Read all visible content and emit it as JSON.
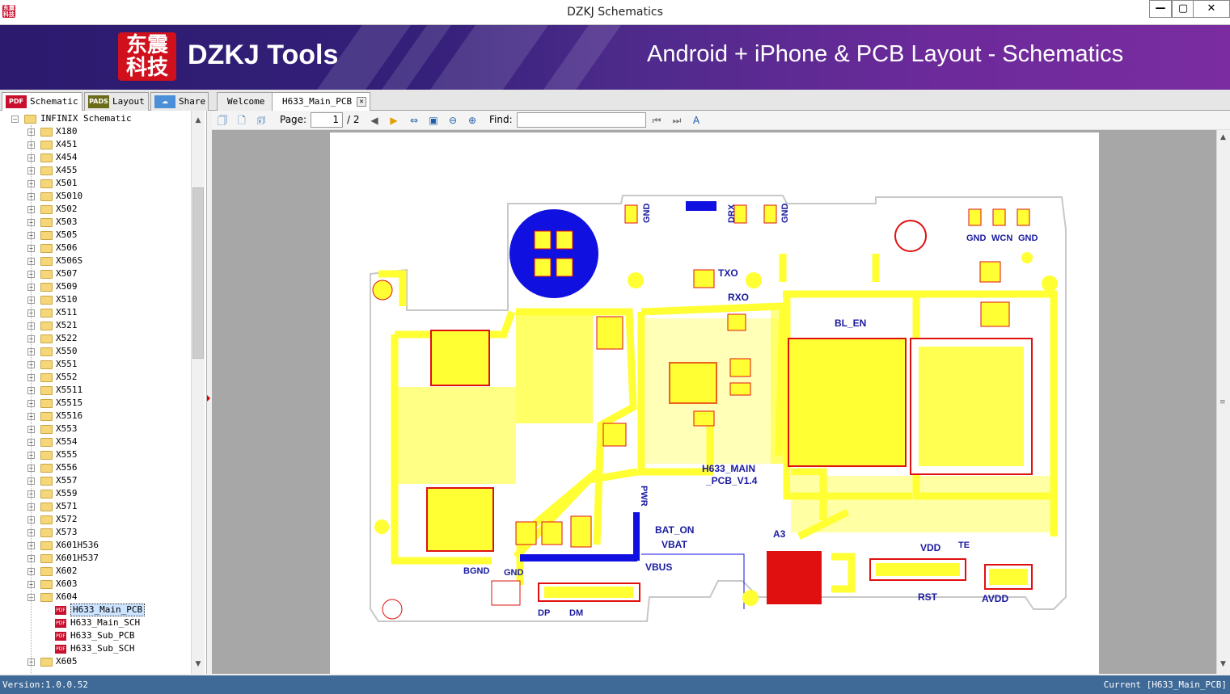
{
  "window": {
    "title": "DZKJ Schematics",
    "app_icon_text": "东震科技"
  },
  "banner": {
    "logo_text": "东震科技",
    "brand": "DZKJ Tools",
    "tagline": "Android + iPhone & PCB Layout - Schematics"
  },
  "main_tabs": [
    {
      "label": "Schematic",
      "icon": "PDF",
      "icon_color": "#c8102e",
      "active": true
    },
    {
      "label": "Layout",
      "icon": "PADS",
      "icon_color": "#6b6b1a",
      "active": false
    },
    {
      "label": "Share",
      "icon": "share-icon",
      "icon_color": "#4a8fd8",
      "active": false
    }
  ],
  "doc_tabs": [
    {
      "label": "Welcome",
      "active": false
    },
    {
      "label": "H633_Main_PCB",
      "active": true
    }
  ],
  "tree": {
    "root": "INFINIX Schematic",
    "folders": [
      "X180",
      "X451",
      "X454",
      "X455",
      "X501",
      "X5010",
      "X502",
      "X503",
      "X505",
      "X506",
      "X506S",
      "X507",
      "X509",
      "X510",
      "X511",
      "X521",
      "X522",
      "X550",
      "X551",
      "X552",
      "X5511",
      "X5515",
      "X5516",
      "X553",
      "X554",
      "X555",
      "X556",
      "X557",
      "X559",
      "X571",
      "X572",
      "X573",
      "X601H536",
      "X601H537",
      "X602",
      "X603",
      "X604"
    ],
    "expanded_folder": "X604",
    "files": [
      {
        "label": "H633_Main_PCB",
        "selected": true
      },
      {
        "label": "H633_Main_SCH",
        "selected": false
      },
      {
        "label": "H633_Sub_PCB",
        "selected": false
      },
      {
        "label": "H633_Sub_SCH",
        "selected": false
      }
    ],
    "after_folders": [
      "X605"
    ]
  },
  "toolbar": {
    "page_label": "Page:",
    "page_current": "1",
    "page_total": "/ 2",
    "find_label": "Find:",
    "find_value": ""
  },
  "pcb": {
    "board_title": "H633_MAIN",
    "board_subtitle": "_PCB_V1.4",
    "labels": {
      "gnd1": "GND",
      "drx": "DRX",
      "gnd2": "GND",
      "gnd3": "GND",
      "wcn": "WCN",
      "gnd4": "GND",
      "txo": "TXO",
      "rxo": "RXO",
      "bl_en": "BL_EN",
      "pwr": "PWR",
      "bat_on": "BAT_ON",
      "vbat": "VBAT",
      "vbus": "VBUS",
      "bgnd": "BGND",
      "gnd5": "GND",
      "dp": "DP",
      "dm": "DM",
      "a3": "A3",
      "vdd": "VDD",
      "te": "TE",
      "rst": "RST",
      "avdd": "AVDD"
    }
  },
  "status": {
    "version": "Version:1.0.0.52",
    "current": "Current [H633_Main_PCB]"
  },
  "colors": {
    "pcb_yellow": "#ffff33",
    "pcb_red": "#e01010",
    "pcb_blue": "#1010e0",
    "status_bg": "#3f6996"
  }
}
